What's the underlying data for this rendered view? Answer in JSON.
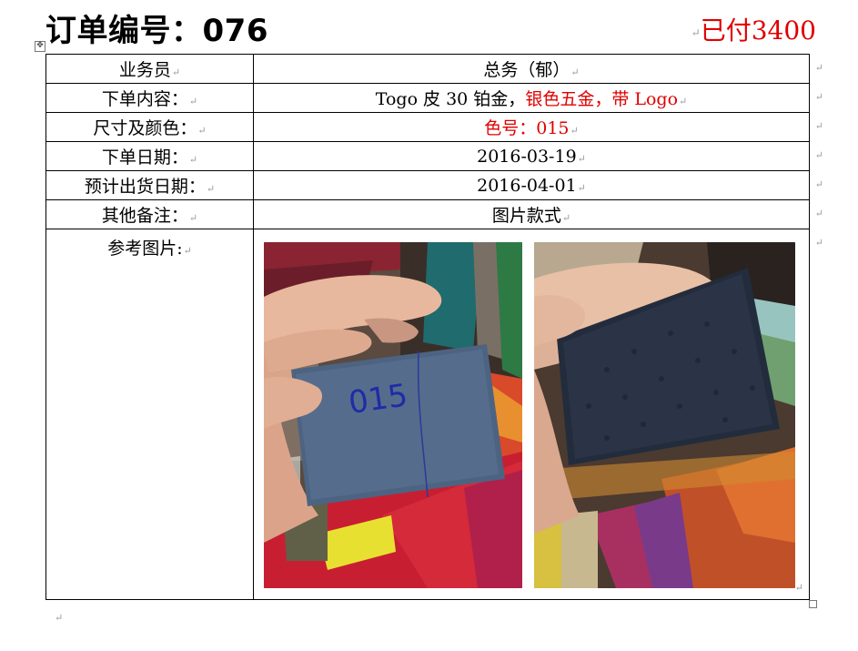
{
  "header": {
    "title": "订单编号：076",
    "paid": "已付3400"
  },
  "rows": [
    {
      "label": "业务员",
      "value": "总务（郁）"
    },
    {
      "label": "下单内容：",
      "value_parts": [
        {
          "text": "Togo 皮 30 铂金，",
          "color": "#000000"
        },
        {
          "text": "银色五金，带 Logo",
          "color": "#e00000"
        }
      ]
    },
    {
      "label": "尺寸及颜色：",
      "value": "色号：015",
      "value_color": "#e00000"
    },
    {
      "label": "下单日期：",
      "value": "2016-03-19"
    },
    {
      "label": "预计出货日期：",
      "value": "2016-04-01"
    },
    {
      "label": "其他备注：",
      "value": "图片款式"
    },
    {
      "label": "参考图片:",
      "value": ""
    }
  ],
  "photos": [
    {
      "name": "swatch-photo-1",
      "handwritten": "015"
    },
    {
      "name": "swatch-photo-2"
    }
  ],
  "marks": {
    "paragraph": "↵",
    "anchor": "✥"
  },
  "colors": {
    "accent_red": "#e00000"
  }
}
